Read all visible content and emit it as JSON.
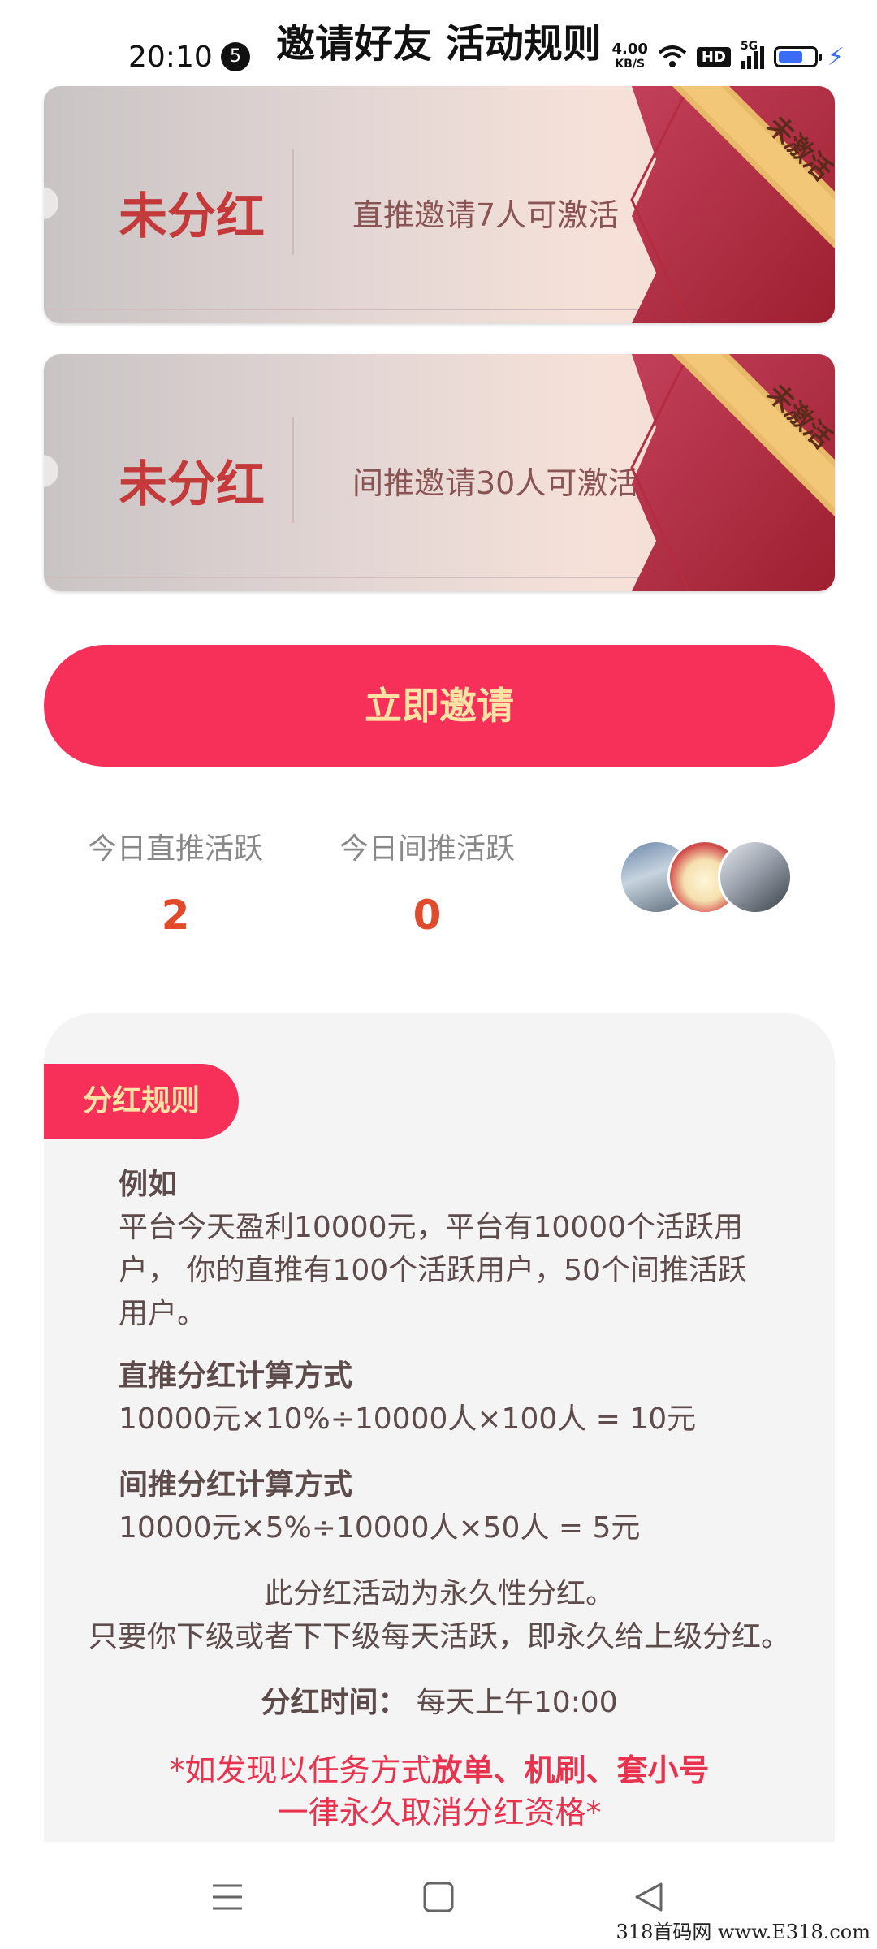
{
  "status_bar": {
    "time": "20:10",
    "notification_count": "5",
    "net_speed_value": "4.00",
    "net_speed_unit": "KB/S",
    "hd_label": "HD",
    "signal_label": "5G"
  },
  "header": {
    "title": "邀请好友 活动规则"
  },
  "cards": [
    {
      "status": "未分红",
      "description": "直推邀请7人可激活",
      "badge": "未激活"
    },
    {
      "status": "未分红",
      "description": "间推邀请30人可激活",
      "badge": "未激活"
    }
  ],
  "invite_button": {
    "label": "立即邀请"
  },
  "stats": [
    {
      "label": "今日直推活跃",
      "value": "2"
    },
    {
      "label": "今日间推活跃",
      "value": "0"
    }
  ],
  "rules": {
    "tab_label": "分红规则",
    "example_heading": "例如",
    "example_text": "平台今天盈利10000元，平台有10000个活跃用户， 你的直推有100个活跃用户，50个间推活跃用户。",
    "direct_heading": "直推分红计算方式",
    "direct_formula": "10000元×10%÷10000人×100人 = 10元",
    "indirect_heading": "间推分红计算方式",
    "indirect_formula": "10000元×5%÷10000人×50人 = 5元",
    "permanent_line1": "此分红活动为永久性分红。",
    "permanent_line2": "只要你下级或者下下级每天活跃，即永久给上级分红。",
    "time_label": "分红时间",
    "time_value": "每天上午10:00",
    "warning_prefix": "*如发现以任务方式",
    "warning_bold": "放单、机刷、套小号",
    "warning_line2": "一律永久取消分红资格*"
  },
  "watermark": "318首码网 www.E318.com",
  "colors": {
    "accent": "#f7305a",
    "accent_text": "#ffe3a4",
    "card_status": "#c43a3a",
    "stat_value": "#e24a2c"
  }
}
